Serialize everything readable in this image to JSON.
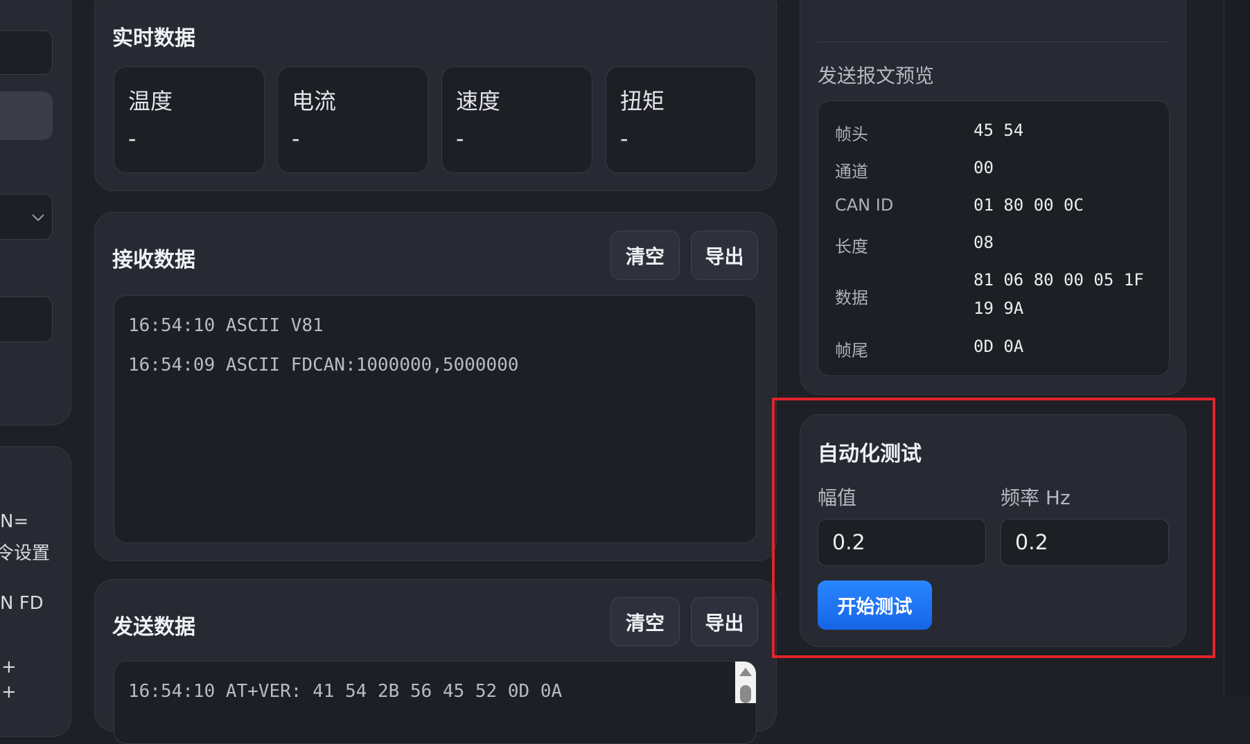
{
  "realtime": {
    "title": "实时数据",
    "cards": [
      {
        "label": "温度",
        "value": "-"
      },
      {
        "label": "电流",
        "value": "-"
      },
      {
        "label": "速度",
        "value": "-"
      },
      {
        "label": "扭矩",
        "value": "-"
      }
    ]
  },
  "receive": {
    "title": "接收数据",
    "clear_label": "清空",
    "export_label": "导出",
    "log": [
      "16:54:10 ASCII V81",
      "16:54:09 ASCII FDCAN:1000000,5000000"
    ]
  },
  "send": {
    "title": "发送数据",
    "clear_label": "清空",
    "export_label": "导出",
    "log": [
      "16:54:10 AT+VER: 41 54 2B 56 45 52 0D 0A"
    ]
  },
  "preview": {
    "title": "发送报文预览",
    "rows": [
      {
        "key": "帧头",
        "value": "45 54"
      },
      {
        "key": "通道",
        "value": "00"
      },
      {
        "key": "CAN ID",
        "value": "01 80 00 0C"
      },
      {
        "key": "长度",
        "value": "08"
      },
      {
        "key": "数据",
        "value": "81 06 80 00 05 1F",
        "value2": "19 9A"
      },
      {
        "key": "帧尾",
        "value": "0D 0A"
      }
    ]
  },
  "autotest": {
    "title": "自动化测试",
    "amplitude_label": "幅值",
    "amplitude_value": "0.2",
    "frequency_label": "频率 Hz",
    "frequency_value": "0.2",
    "start_label": "开始测试"
  },
  "left_fragments": {
    "line1": "N=",
    "line2": "令设置",
    "line3": "N FD",
    "plus1": "+",
    "plus2": "+"
  },
  "colors": {
    "accent": "#1a73f0",
    "highlight": "#e0242a"
  }
}
